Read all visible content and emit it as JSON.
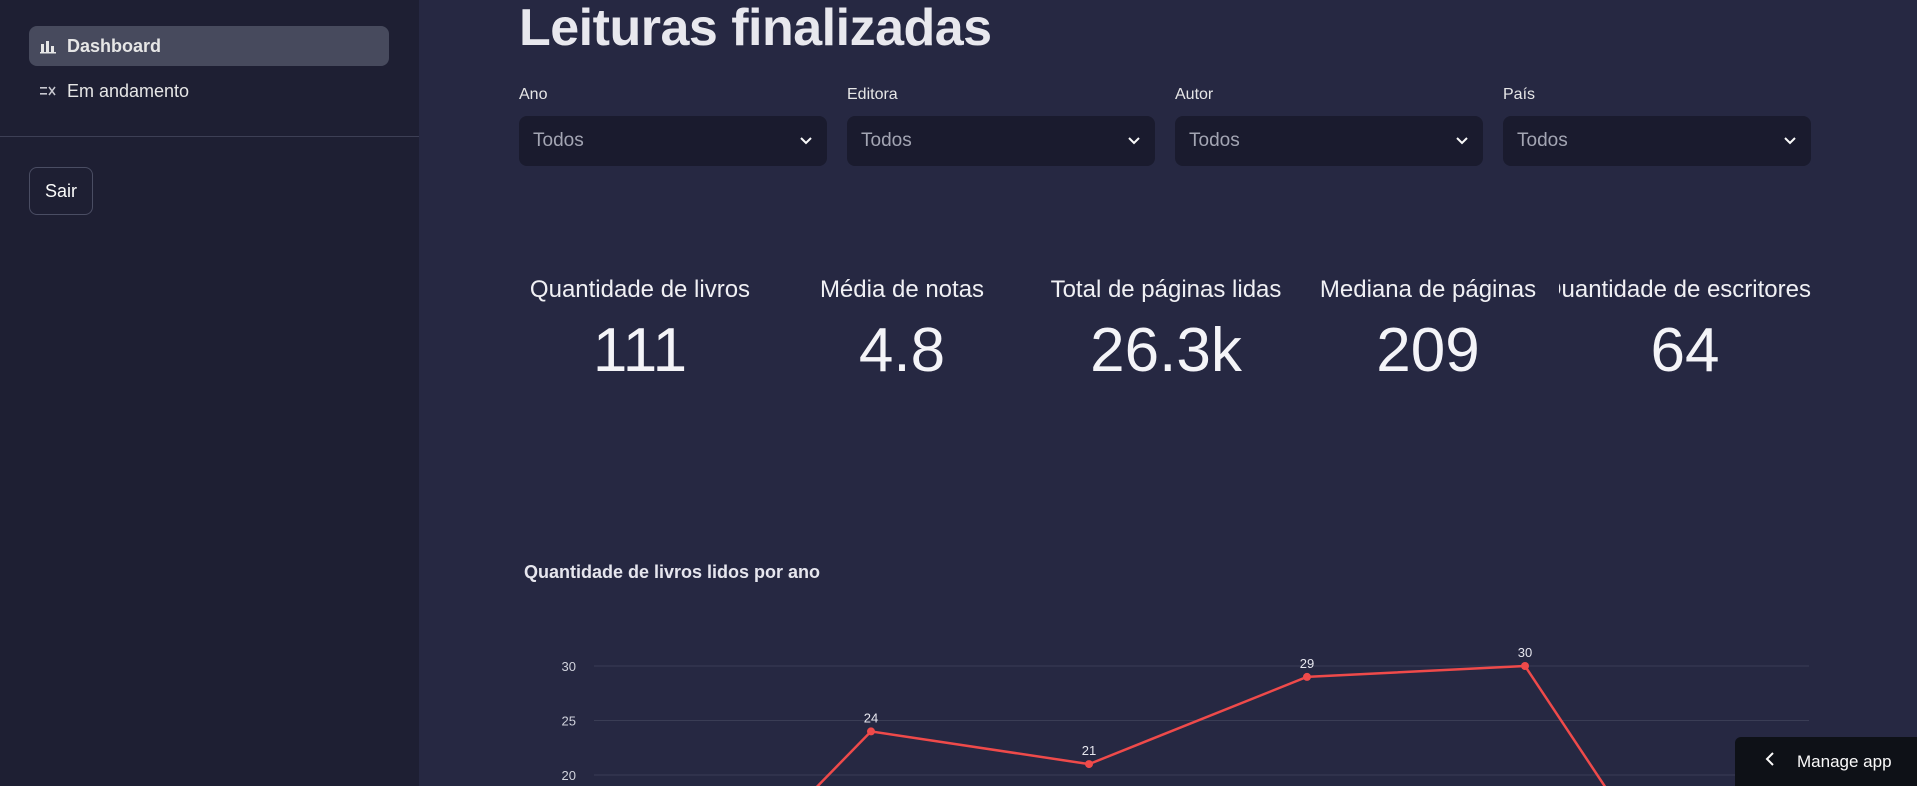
{
  "sidebar": {
    "nav": [
      {
        "label": "Dashboard",
        "icon": "bar-chart-icon",
        "active": true
      },
      {
        "label": "Em andamento",
        "icon": "checklist-icon",
        "active": false
      }
    ],
    "logout_label": "Sair"
  },
  "main": {
    "title": "Leituras finalizadas",
    "filters": [
      {
        "label": "Ano",
        "value": "Todos"
      },
      {
        "label": "Editora",
        "value": "Todos"
      },
      {
        "label": "Autor",
        "value": "Todos"
      },
      {
        "label": "País",
        "value": "Todos"
      }
    ],
    "metrics": [
      {
        "label": "Quantidade de livros",
        "value": "111"
      },
      {
        "label": "Média de notas",
        "value": "4.8"
      },
      {
        "label": "Total de páginas lidas",
        "value": "26.3k"
      },
      {
        "label": "Mediana de páginas",
        "value": "209"
      },
      {
        "label": "Quantidade de escritores",
        "value": "64"
      }
    ]
  },
  "manage_app_label": "Manage app",
  "chart_data": {
    "type": "line",
    "title": "Quantidade de livros lidos por ano",
    "xlabel": "",
    "ylabel": "",
    "y_ticks": [
      20,
      25,
      30
    ],
    "points": [
      {
        "y": 24,
        "label": "24"
      },
      {
        "y": 21,
        "label": "21"
      },
      {
        "y": 29,
        "label": "29"
      },
      {
        "y": 30,
        "label": "30"
      }
    ],
    "line_color": "#ef4a4a",
    "grid": true
  }
}
